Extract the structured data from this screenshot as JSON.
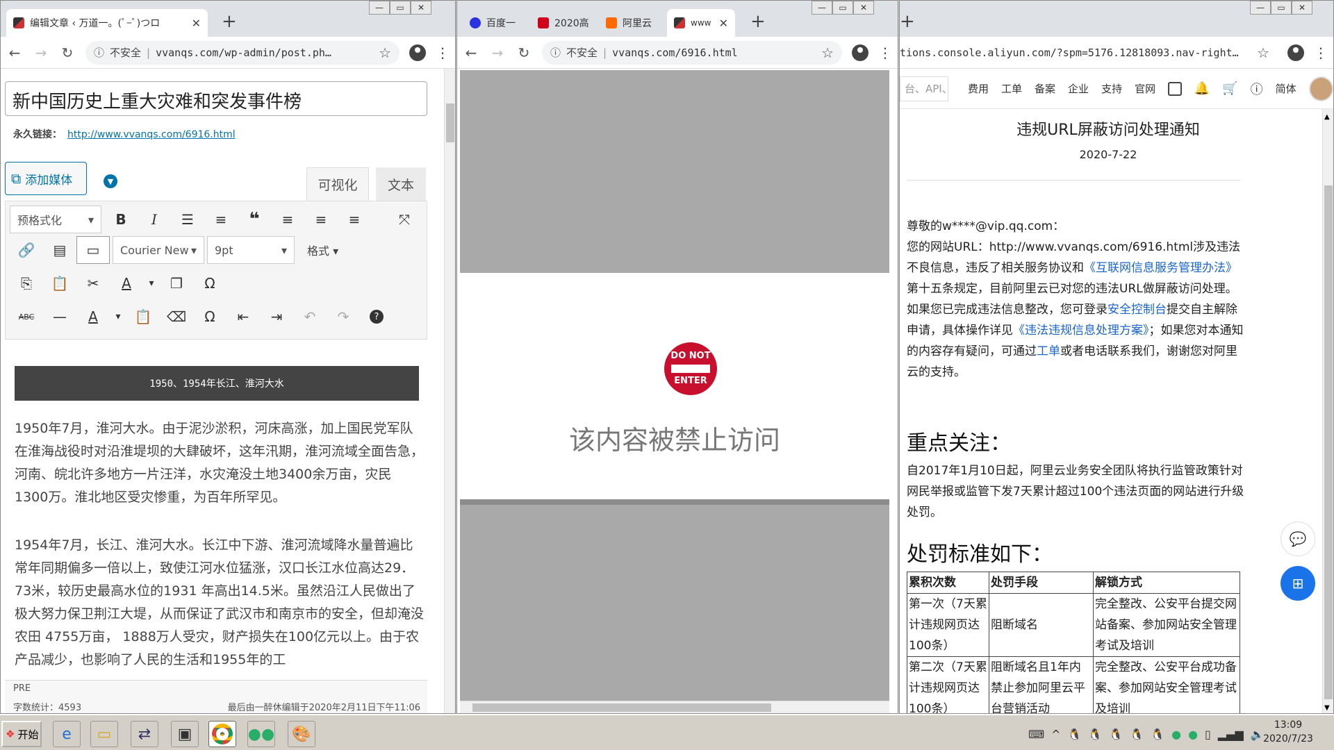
{
  "windowA": {
    "tabs": [
      {
        "label": "编辑文章 ‹ 万道一。(ﾟ−ﾟ)つロ"
      }
    ],
    "address": {
      "security": "不安全",
      "url": "vvanqs.com/wp-admin/post.ph…"
    },
    "post_title": "新中国历史上重大灾难和突发事件榜",
    "permalink_label": "永久链接：",
    "permalink_url": "http://www.vvanqs.com/6916.html",
    "add_media": "添加媒体",
    "tab_visual": "可视化",
    "tab_text": "文本",
    "format_select": "预格式化",
    "font_family": "Courier New",
    "font_size": "9pt",
    "format_menu": "格式",
    "heading_bar": "1950、1954年长江、淮河大水",
    "paragraph1": "1950年7月，淮河大水。由于泥沙淤积，河床高涨，加上国民党军队在淮海战役时对沿淮堤坝的大肆破坏，这年汛期，淮河流域全面告急，河南、皖北许多地方一片汪洋，水灾淹没土地3400余万亩，灾民1300万。淮北地区受灾惨重，为百年所罕见。",
    "paragraph2": "1954年7月，长江、淮河大水。长江中下游、淮河流域降水量普遍比常年同期偏多一倍以上，致使江河水位猛涨，汉口长江水位高达29．73米，较历史最高水位的1931 年高出14.5米。虽然沿江人民做出了极大努力保卫荆江大堤，从而保证了武汉市和南京市的安全，但却淹没农田 4755万亩， 1888万人受灾，财产损失在100亿元以上。由于农产品减少，也影响了人民的生活和1955年的工",
    "path_label": "PRE",
    "word_count": "字数统计：4593",
    "last_edit": "最后由一醉休编辑于2020年2月11日下午11:06"
  },
  "windowB": {
    "tabs": [
      {
        "label": "百度一"
      },
      {
        "label": "2020高"
      },
      {
        "label": "阿里云"
      },
      {
        "label": "www"
      }
    ],
    "address": {
      "security": "不安全",
      "url": "vvanqs.com/6916.html"
    },
    "sign_line1": "DO NOT",
    "sign_line2": "ENTER",
    "forbidden_text": "该内容被禁止访问"
  },
  "windowC": {
    "address": {
      "url": "tions.console.aliyun.com/?spm=5176.12818093.nav-right…"
    },
    "search_placeholder": "台、API、",
    "nav": [
      "费用",
      "工单",
      "备案",
      "企业",
      "支持",
      "官网",
      "简体"
    ],
    "notice_title": "违规URL屏蔽访问处理通知",
    "notice_date": "2020-7-22",
    "greeting": "尊敬的w****@vip.qq.com：",
    "body_a": "您的网站URL：http://www.vvanqs.com/6916.html涉及违法不良信息，违反了相关服务协议和",
    "link_rule": "《互联网信息服务管理办法》",
    "body_b": "第十五条规定，目前阿里云已对您的违法URL做屏蔽访问处理。如果您已完成违法信息整改，您可登录",
    "link_console": "安全控制台",
    "body_c": "提交自主解除申请，具体操作详见",
    "link_plan": "《违法违规信息处理方案》",
    "body_d": "；如果您对本通知的内容存有疑问，可通过",
    "link_ticket": "工单",
    "body_e": "或者电话联系我们，谢谢您对阿里云的支持。",
    "focus_heading": "重点关注：",
    "focus_text": "自2017年1月10日起，阿里云业务安全团队将执行监管政策针对网民举报或监管下发7天累计超过100个违法页面的网站进行升级处罚。",
    "penalty_heading": "处罚标准如下：",
    "table_headers": [
      "累积次数",
      "处罚手段",
      "解锁方式"
    ],
    "table_rows": [
      [
        "第一次（7天累计违规网页达100条）",
        "阻断域名",
        "完全整改、公安平台提交网站备案、参加网站安全管理考试及培训"
      ],
      [
        "第二次（7天累计违规网页达100条）",
        "阻断域名且1年内禁止参加阿里云平台营销活动",
        "完全整改、公安平台成功备案、参加网站安全管理考试及培训"
      ]
    ]
  },
  "taskbar": {
    "start": "开始",
    "time": "13:09",
    "date": "2020/7/23"
  },
  "colors": {
    "wp_blue": "#0073aa",
    "stop_red": "#c8102e",
    "aliyun_link": "#1a66cc"
  }
}
